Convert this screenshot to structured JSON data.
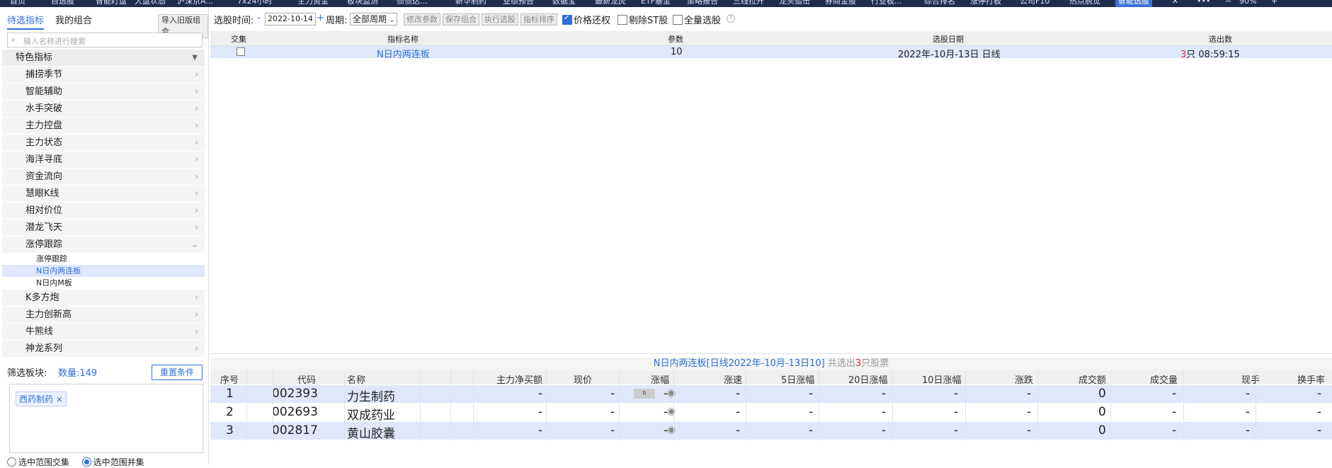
{
  "topnav": {
    "items": [
      "首页",
      "自选股",
      "智能盯盘",
      "大盘状态",
      "沪深京A...",
      "7x24小时",
      "主力资金",
      "板块监测",
      "债债达...",
      "新华制药",
      "业绩预告",
      "数据宝",
      "最新龙虎",
      "ETF基金",
      "策略报告",
      "三线拉升",
      "龙头追击",
      "券商金股",
      "行业板...",
      "综合排名",
      "涨停打板",
      "公司F10",
      "热点脱觉",
      "智能选股"
    ],
    "zoom": "90%"
  },
  "left": {
    "tabs": [
      "待选指标",
      "我的组合"
    ],
    "import_btn": "导入旧版组合",
    "search_placeholder": "输入名称进行搜索",
    "group": "特色指标",
    "items": [
      {
        "label": "捕捞季节"
      },
      {
        "label": "智能辅助"
      },
      {
        "label": "水手突破"
      },
      {
        "label": "主力控盘"
      },
      {
        "label": "主力状态"
      },
      {
        "label": "海洋寻底"
      },
      {
        "label": "资金流向"
      },
      {
        "label": "慧眼K线"
      },
      {
        "label": "相对价位"
      },
      {
        "label": "潜龙飞天"
      },
      {
        "label": "涨停跟踪"
      }
    ],
    "subitems": [
      "涨停跟踪",
      "N日内两连板",
      "N日内M板"
    ],
    "items2": [
      {
        "label": "K多方炮"
      },
      {
        "label": "主力创新高"
      },
      {
        "label": "牛熊线"
      },
      {
        "label": "神龙系列"
      }
    ],
    "filter_label": "筛选板块:",
    "count_label": "数量:149",
    "reset_btn": "重置条件",
    "tag": "西药制药 ×",
    "radio1": "选中范围交集",
    "radio2": "选中范围并集"
  },
  "toolbar": {
    "date_label": "选股时间:",
    "minus": "-",
    "date": "2022-10-14",
    "plus": "+",
    "period_label": "周期:",
    "period": "全部周期",
    "btn1": "修改参数",
    "btn2": "保存组合",
    "btn3": "执行选股",
    "btn4": "指标排序",
    "chk1": "价格还权",
    "chk2": "剔除ST股",
    "chk3": "全量选股",
    "help": "?"
  },
  "top_table": {
    "headers": [
      "交集",
      "指标名称",
      "参数",
      "选股日期",
      "选出数"
    ],
    "row": {
      "name": "N日内两连板",
      "param": "10",
      "date": "2022年-10月-13日 日线",
      "count": "3",
      "count_suffix": "只 08:59:15"
    }
  },
  "bottom": {
    "title": "N日内两连板[日线2022年-10月-13日10]",
    "total_prefix": "共选出",
    "total_count": "3",
    "total_suffix": "只股票",
    "headers": [
      "序号",
      "代码",
      "名称",
      "",
      "",
      "主力净买额",
      "现价",
      "涨幅",
      "涨速",
      "5日涨幅",
      "20日涨幅",
      "10日涨幅",
      "涨跌",
      "成交额",
      "成交量",
      "现手",
      "换手率"
    ],
    "rows": [
      {
        "no": "1",
        "code": "002393",
        "name": "力生制药",
        "r": "R",
        "v1": "-",
        "v2": "-",
        "v3": "-",
        "v4": "-",
        "v5": "-",
        "v6": "-",
        "v7": "-",
        "v8": "-",
        "v9": "0",
        "v10": "-",
        "v11": "-",
        "v12": "-"
      },
      {
        "no": "2",
        "code": "002693",
        "name": "双成药业",
        "r": "",
        "v1": "-",
        "v2": "-",
        "v3": "-",
        "v4": "-",
        "v5": "-",
        "v6": "-",
        "v7": "-",
        "v8": "-",
        "v9": "0",
        "v10": "-",
        "v11": "-",
        "v12": "-"
      },
      {
        "no": "3",
        "code": "002817",
        "name": "黄山胶囊",
        "r": "",
        "v1": "-",
        "v2": "-",
        "v3": "-",
        "v4": "-",
        "v5": "-",
        "v6": "-",
        "v7": "-",
        "v8": "-",
        "v9": "0",
        "v10": "-",
        "v11": "-",
        "v12": "-"
      }
    ]
  },
  "colors": {
    "accent": "#2f6fd8",
    "red": "#e03030",
    "selected_bg": "#dfe7fb"
  }
}
